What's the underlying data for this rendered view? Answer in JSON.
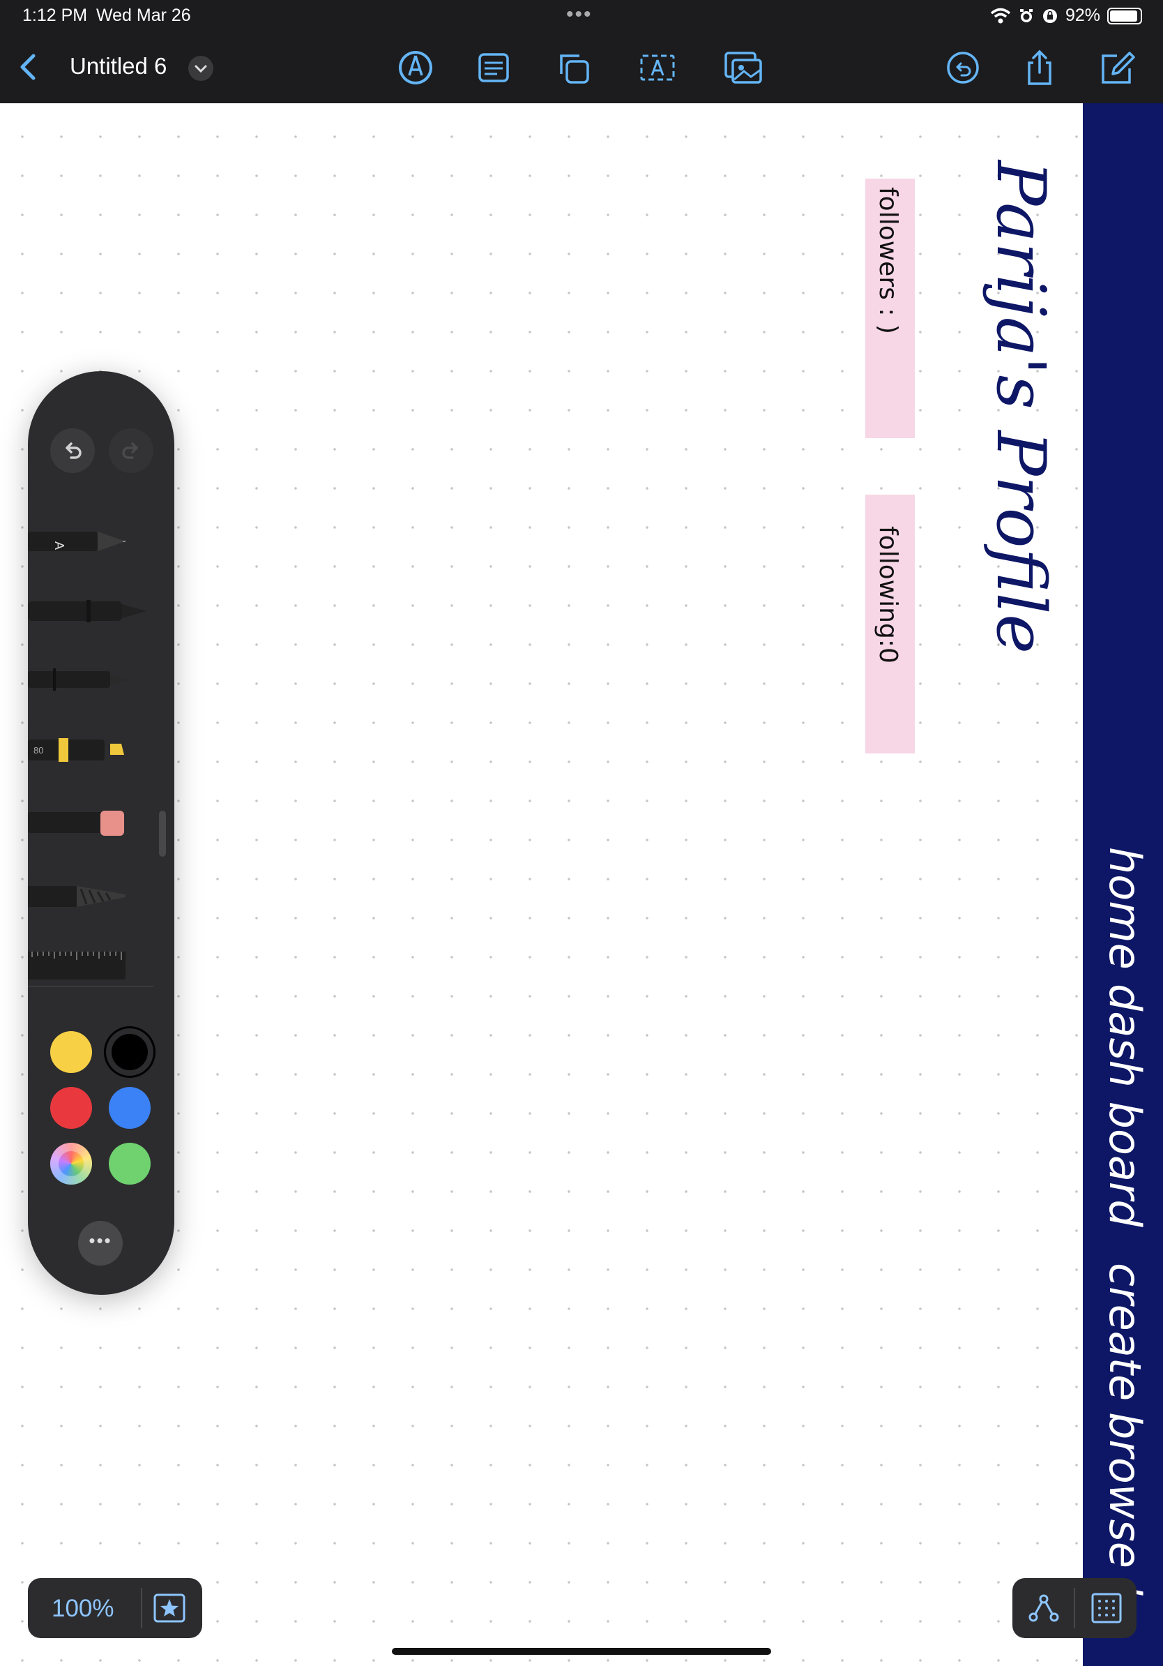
{
  "status_bar": {
    "time": "1:12 PM",
    "date": "Wed Mar 26",
    "battery": "92%",
    "battery_level": 0.92,
    "icons": [
      "wifi-icon",
      "alarm-icon",
      "rotation-lock-icon"
    ]
  },
  "top_bar": {
    "back_icon": "chevron-left-icon",
    "doc_title": "Untitled 6",
    "title_menu_icon": "chevron-down-icon",
    "tools": [
      "pen-tool-icon",
      "sticky-note-icon",
      "shapes-icon",
      "text-box-icon",
      "media-icon"
    ],
    "actions": [
      "undo-history-icon",
      "share-icon",
      "new-board-icon"
    ],
    "accent_color": "#64b5f6"
  },
  "canvas": {
    "heading": "Parija's Profile",
    "notes": [
      {
        "text": "followers : )",
        "color": "#f7d6e6"
      },
      {
        "text": "following:0",
        "color": "#f7d6e6"
      }
    ],
    "nav_bar": {
      "color": "#0e1766",
      "items": [
        "home",
        "dash board",
        "create",
        "browse",
        "lo"
      ]
    }
  },
  "palette": {
    "undo_icon": "undo-icon",
    "redo_icon": "redo-icon",
    "tools": [
      "monoline-pen",
      "fountain-pen",
      "fineliner",
      "highlighter",
      "eraser",
      "pencil",
      "ruler"
    ],
    "highlighter_label": "80",
    "monoline_label": "A",
    "colors": [
      {
        "name": "yellow",
        "hex": "#f7d046"
      },
      {
        "name": "black",
        "hex": "#000000",
        "selected": true
      },
      {
        "name": "red",
        "hex": "#e9393f"
      },
      {
        "name": "blue",
        "hex": "#3b82f6"
      },
      {
        "name": "multicolor",
        "hex": "conic"
      },
      {
        "name": "green",
        "hex": "#6fd26f"
      }
    ],
    "more_icon": "ellipsis-icon",
    "more_label": "•••"
  },
  "zoom": {
    "level": "100%",
    "favorites_icon": "star-box-icon"
  },
  "bottom_tools": {
    "icons": [
      "connector-icon",
      "grid-icon"
    ]
  }
}
